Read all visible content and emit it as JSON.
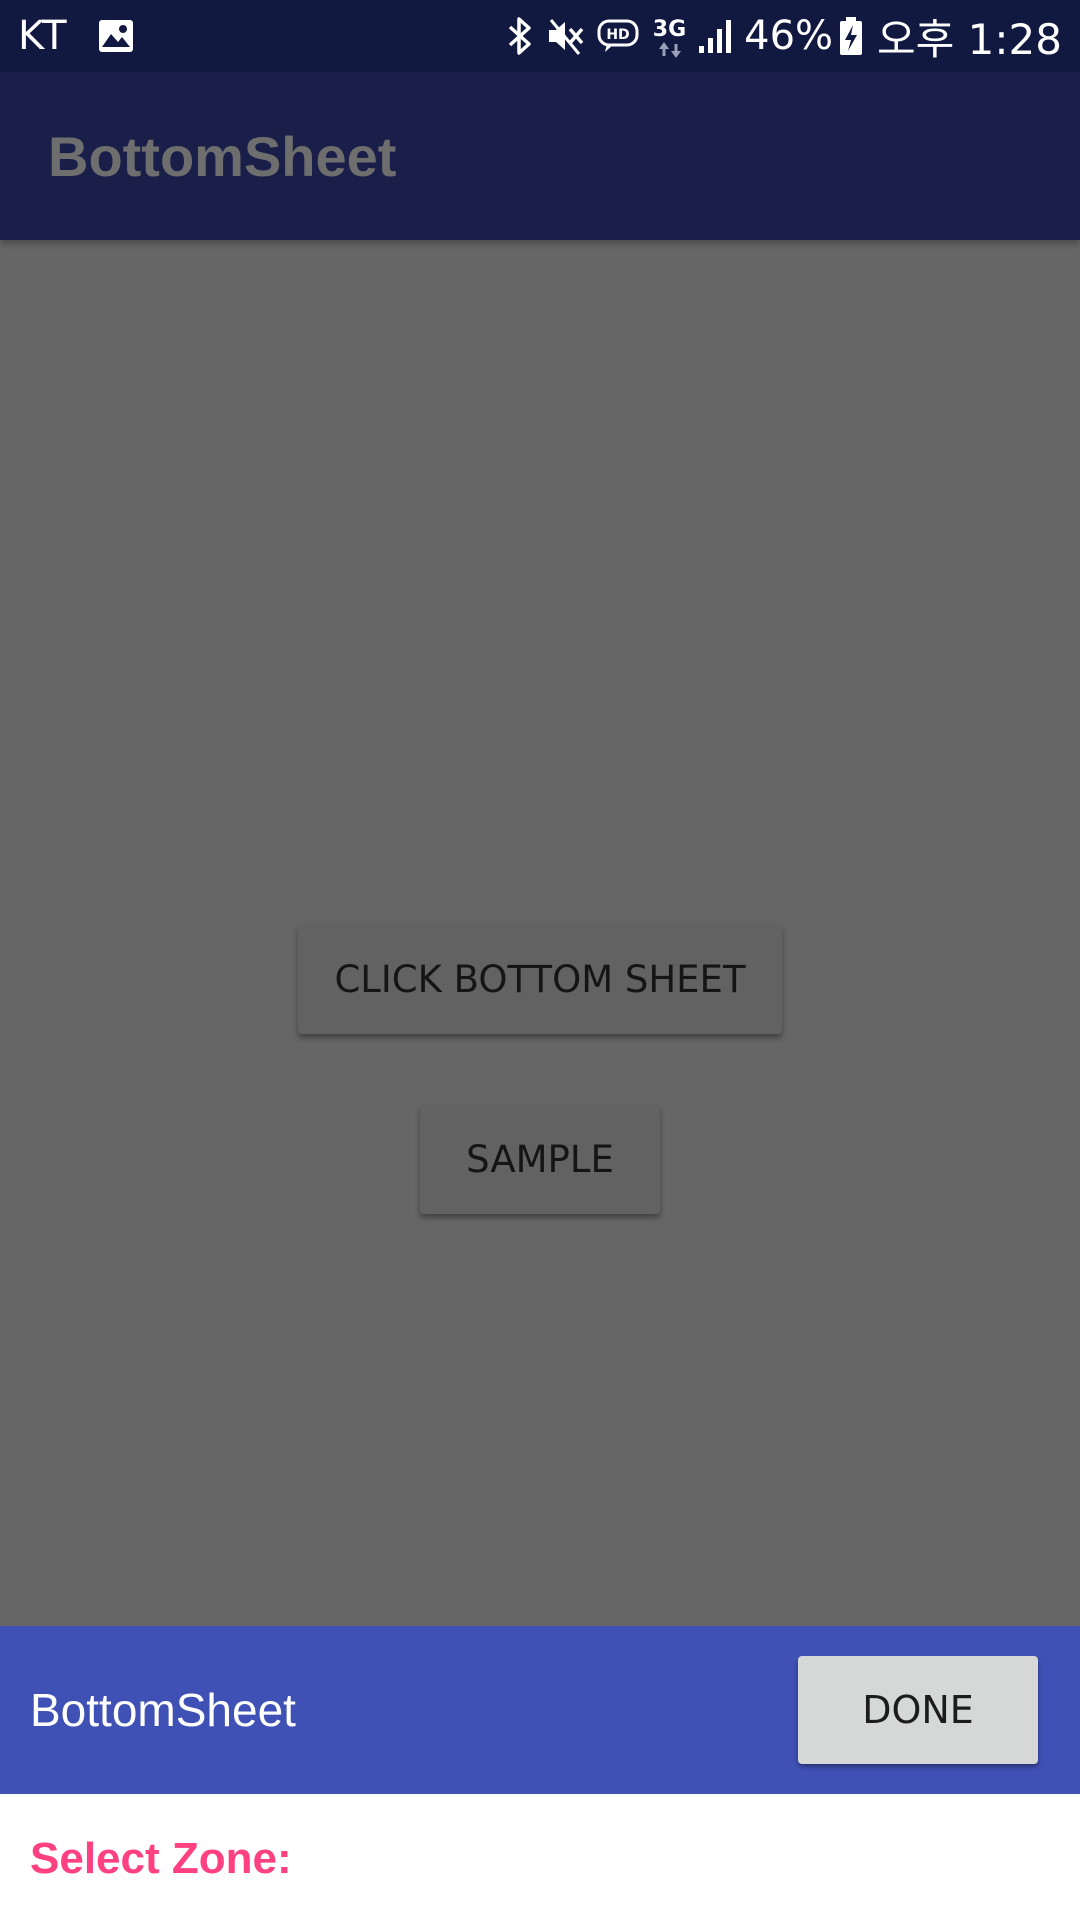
{
  "status_bar": {
    "carrier": "KT",
    "network_type": "3G",
    "battery_percent": "46%",
    "time": "오후 1:28",
    "icons": [
      "image-icon",
      "bluetooth-icon",
      "mute-icon",
      "hd-voice-icon",
      "network-arrows-icon",
      "signal-icon",
      "battery-charging-icon"
    ]
  },
  "app_bar": {
    "title": "BottomSheet"
  },
  "content": {
    "bottom_sheet_button_label": "CLICK BOTTOM SHEET",
    "sample_button_label": "SAMPLE"
  },
  "bottom_sheet": {
    "title": "BottomSheet",
    "done_label": "DONE",
    "zone_label": "Select Zone:"
  },
  "colors": {
    "status_bar": "#111941",
    "app_bar": "#1a1f4a",
    "scrim": "#666666",
    "sheet_header": "#3f51b5",
    "accent": "#ff4081"
  }
}
